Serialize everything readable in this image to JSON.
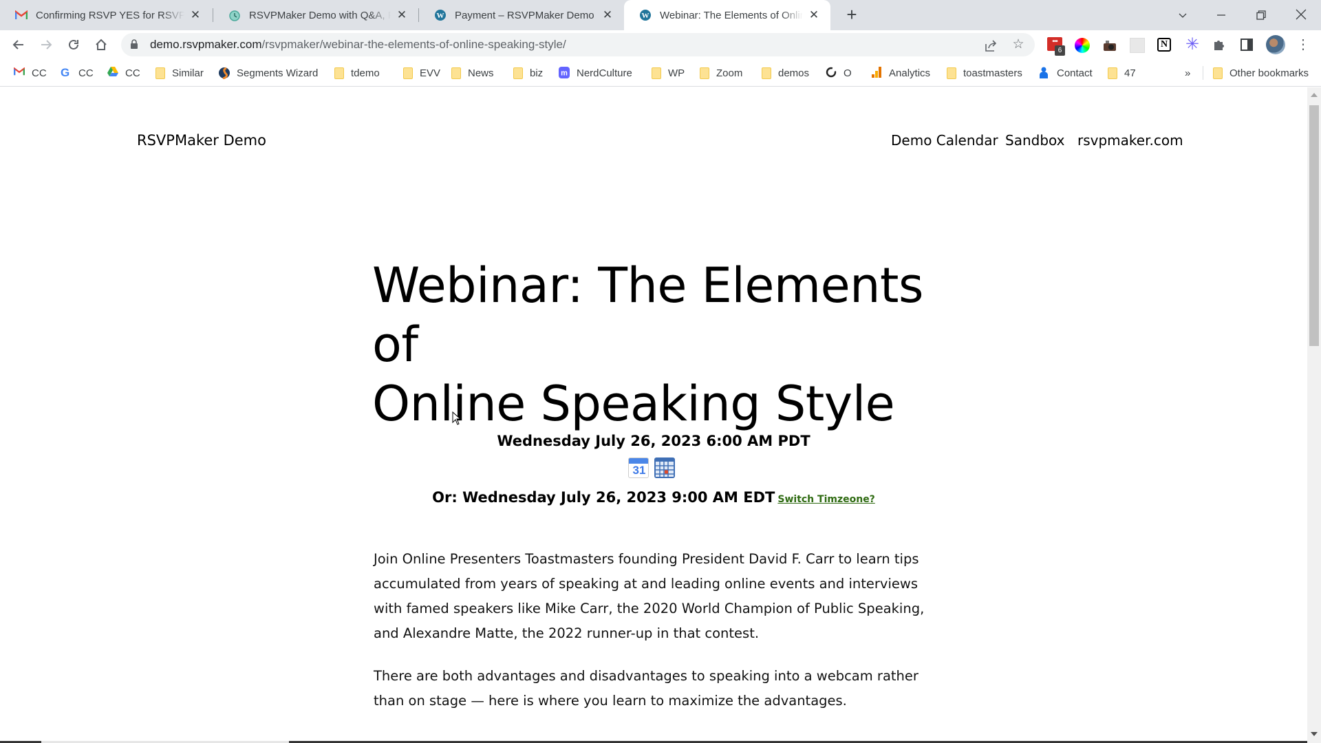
{
  "browser": {
    "tabs": [
      {
        "title": "Confirming RSVP YES for RSVPMaker Demo",
        "icon": "gmail-icon",
        "active": false
      },
      {
        "title": "RSVPMaker Demo with Q&A, Featured",
        "icon": "clock-icon",
        "active": false
      },
      {
        "title": "Payment – RSVPMaker Demo",
        "icon": "wordpress-icon",
        "active": false
      },
      {
        "title": "Webinar: The Elements of Online Speaking Style",
        "icon": "wordpress-icon",
        "active": true
      }
    ],
    "new_tab_label": "+",
    "window_controls": {
      "tab_search": "⌄",
      "minimize": "—",
      "restore": "❐",
      "close": "✕"
    },
    "nav": {
      "back": "←",
      "forward": "→",
      "reload": "↻",
      "home": "⌂"
    },
    "url": {
      "host": "demo.rsvpmaker.com",
      "path": "/rsvpmaker/webinar-the-elements-of-online-speaking-style/"
    },
    "extensions_badge": "6",
    "bookmarks": [
      {
        "label": "CC",
        "icon": "gmail-icon"
      },
      {
        "label": "CC",
        "icon": "google-icon"
      },
      {
        "label": "CC",
        "icon": "google-drive-icon"
      },
      {
        "label": "Similar",
        "icon": "folder-icon"
      },
      {
        "label": "Segments Wizard",
        "icon": "segments-icon"
      },
      {
        "label": "tdemo",
        "icon": "folder-icon"
      },
      {
        "label": "EVV",
        "icon": "folder-icon"
      },
      {
        "label": "News",
        "icon": "folder-icon"
      },
      {
        "label": "biz",
        "icon": "folder-icon"
      },
      {
        "label": "NerdCulture",
        "icon": "mastodon-icon"
      },
      {
        "label": "WP",
        "icon": "folder-icon"
      },
      {
        "label": "Zoom",
        "icon": "folder-icon"
      },
      {
        "label": "demos",
        "icon": "folder-icon"
      },
      {
        "label": "O",
        "icon": "circle-icon"
      },
      {
        "label": "Analytics",
        "icon": "analytics-icon"
      },
      {
        "label": "toastmasters",
        "icon": "folder-icon"
      },
      {
        "label": "Contact",
        "icon": "person-icon"
      },
      {
        "label": "47",
        "icon": "folder-icon"
      }
    ],
    "bookmarks_overflow": "»",
    "other_bookmarks": "Other bookmarks"
  },
  "site": {
    "title": "RSVPMaker Demo",
    "nav": [
      "Demo Calendar",
      "Sandbox",
      "rsvpmaker.com"
    ]
  },
  "event": {
    "title_line1": "Webinar: The Elements of",
    "title_line2": "Online Speaking Style",
    "datetime": "Wednesday July 26, 2023 6:00 AM PDT",
    "alt_datetime": "Or: Wednesday July 26, 2023 9:00 AM EDT",
    "switch_timezone": "Switch Timzeone?",
    "calendar_links": [
      "google-calendar-icon",
      "ical-calendar-icon"
    ],
    "paragraphs": [
      "Join Online Presenters Toastmasters founding President David F. Carr to learn tips accumulated from years of speaking at and leading online events and interviews with famed speakers like Mike Carr, the 2020 World Champion of Public Speaking, and Alexandre Matte, the 2022 runner-up in that contest.",
      "There are both advantages and disadvantages to speaking into a webcam rather than on stage — here is where you learn to maximize the advantages."
    ]
  },
  "colors": {
    "tabstrip_bg": "#dee1e6",
    "link_green": "#2f6b12",
    "folder_yellow": "#fde293"
  }
}
